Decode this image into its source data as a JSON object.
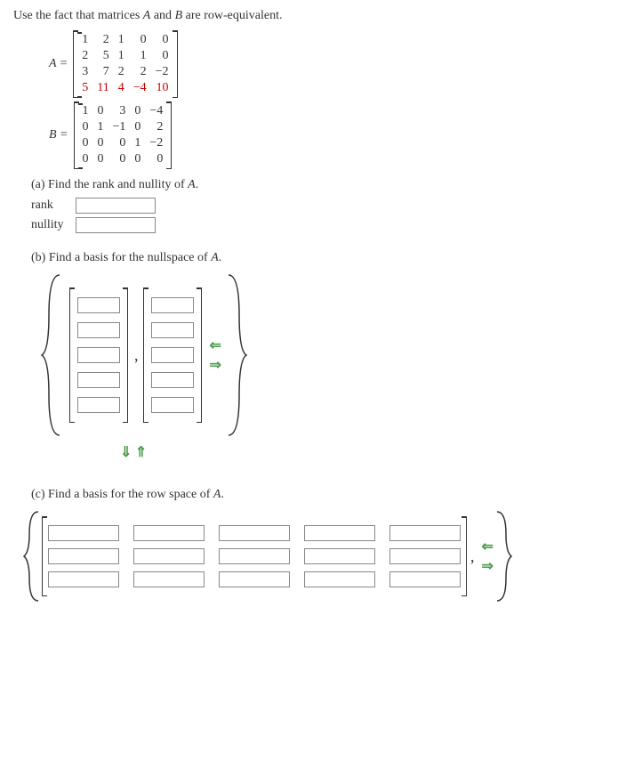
{
  "instruction_pre": "Use the fact that matrices ",
  "instruction_mid1": "A",
  "instruction_mid2": " and ",
  "instruction_mid3": "B",
  "instruction_post": " are row-equivalent.",
  "labelA": "A =",
  "labelB": "B =",
  "matrixA": [
    [
      "1",
      "2",
      "1",
      "0",
      "0"
    ],
    [
      "2",
      "5",
      "1",
      "1",
      "0"
    ],
    [
      "3",
      "7",
      "2",
      "2",
      "−2"
    ],
    [
      "5",
      "11",
      "4",
      "−4",
      "10"
    ]
  ],
  "matrixB": [
    [
      "1",
      "0",
      "3",
      "0",
      "−4"
    ],
    [
      "0",
      "1",
      "−1",
      "0",
      "2"
    ],
    [
      "0",
      "0",
      "0",
      "1",
      "−2"
    ],
    [
      "0",
      "0",
      "0",
      "0",
      "0"
    ]
  ],
  "partA_pre": "(a) Find the rank and nullity of ",
  "partA_var": "A",
  "partA_post": ".",
  "rank_label": "rank",
  "nullity_label": "nullity",
  "partB_pre": "(b) Find a basis for the nullspace of ",
  "partB_var": "A",
  "partB_post": ".",
  "partC_pre": "(c) Find a basis for the row space of ",
  "partC_var": "A",
  "partC_post": ".",
  "arrow_left": "⇐",
  "arrow_right": "⇒",
  "arrow_down": "⇓",
  "arrow_up": "⇑"
}
